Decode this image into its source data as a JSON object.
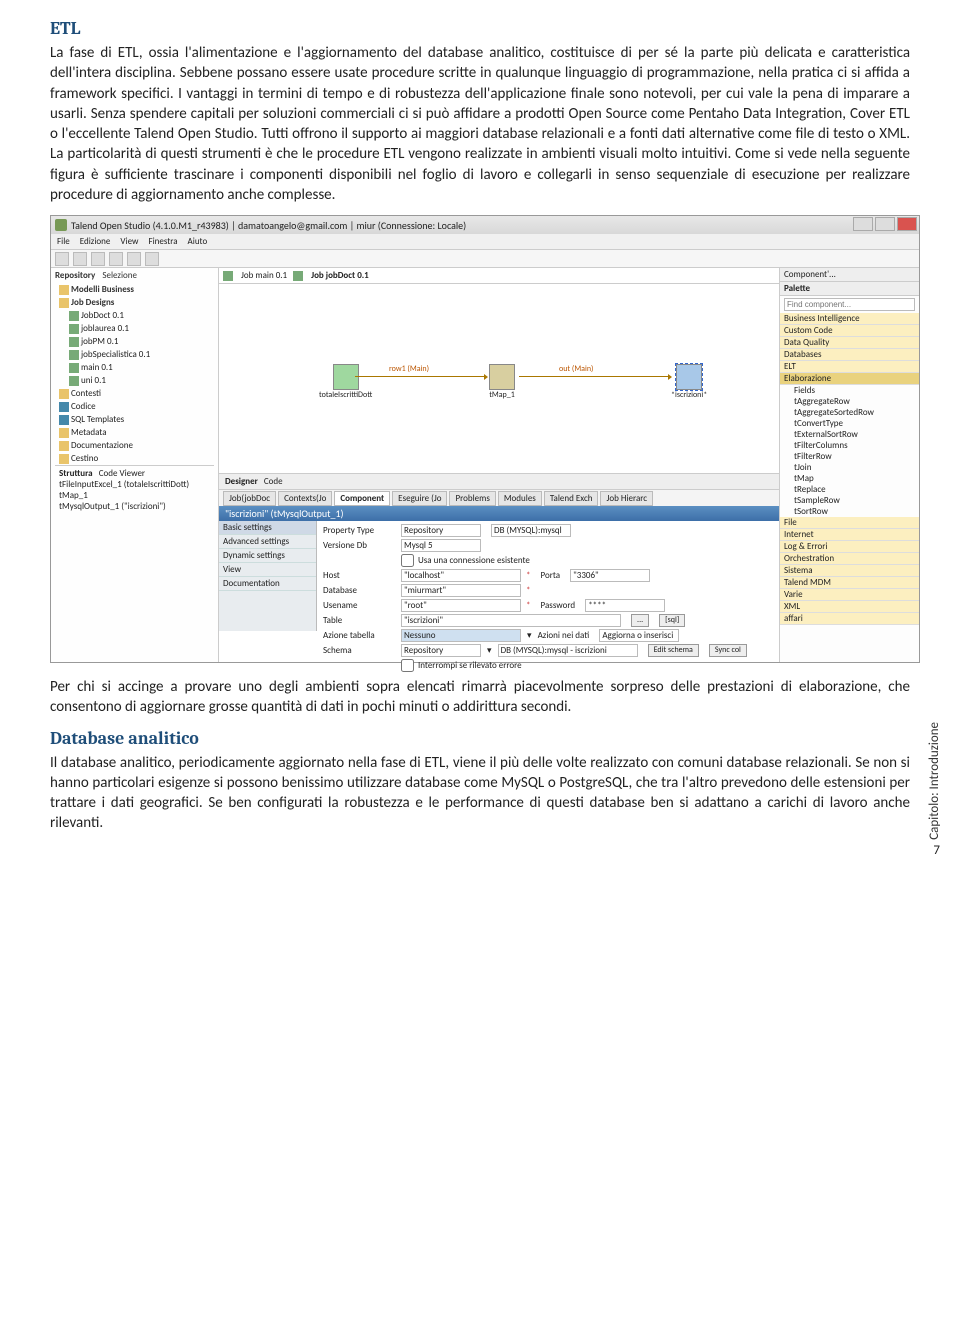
{
  "doc": {
    "section1_title": "ETL",
    "section1_body": "La fase di ETL, ossia l'alimentazione e l'aggiornamento del database analitico, costituisce di per sé la parte più delicata e caratteristica dell'intera disciplina. Sebbene possano essere usate procedure scritte in qualunque linguaggio di programmazione, nella pratica ci si affida a framework specifici. I vantaggi in termini di tempo e di robustezza dell'applicazione finale sono notevoli, per cui vale la pena di imparare a usarli. Senza spendere capitali per soluzioni commerciali ci si può affidare a prodotti Open Source come Pentaho Data Integration, Cover ETL o l'eccellente Talend Open Studio. Tutti offrono il supporto ai maggiori database relazionali e a fonti dati alternative come file di testo o XML. La particolarità di questi strumenti è che le procedure ETL vengono realizzate in ambienti visuali molto intuitivi. Come si vede nella seguente figura è sufficiente trascinare i componenti disponibili nel foglio di lavoro e collegarli in senso sequenziale di esecuzione per realizzare procedure di aggiornamento anche complesse.",
    "para2": "Per chi si accinge a provare uno degli ambienti sopra elencati rimarrà piacevolmente sorpreso delle prestazioni di elaborazione, che consentono di aggiornare grosse quantità di dati in pochi minuti o addirittura secondi.",
    "section2_title": "Database analitico",
    "section2_body": "Il database analitico, periodicamente aggiornato nella fase di ETL, viene il più delle volte realizzato con comuni database relazionali. Se non si hanno particolari esigenze si possono benissimo utilizzare database come MySQL o PostgreSQL, che tra l'altro prevedono delle estensioni per trattare i dati geografici. Se ben configurati la robustezza e le performance di questi database ben si adattano a carichi di lavoro anche rilevanti.",
    "side_caption": "Capitolo: Introduzione",
    "page_number": "7"
  },
  "talend": {
    "title": "Talend Open Studio (4.1.0.M1_r43983) | damatoangelo@gmail.com | miur (Connessione: Locale)",
    "menu": [
      "File",
      "Edizione",
      "View",
      "Finestra",
      "Aiuto"
    ],
    "left": {
      "tabs": [
        "Repository",
        "Selezione"
      ],
      "root_label": "Modelli Business",
      "job_designs": "Job Designs",
      "jobs": [
        "JobDoct 0.1",
        "joblaurea 0.1",
        "jobPM 0.1",
        "jobSpecialistica 0.1",
        "main 0.1",
        "uni 0.1"
      ],
      "others": [
        "Contesti",
        "Codice",
        "SQL Templates",
        "Metadata",
        "Documentazione",
        "Cestino"
      ]
    },
    "center": {
      "tabs": [
        "Job main 0.1",
        "Job jobDoct 0.1"
      ],
      "node1": "totaleIscrittiDott",
      "node2": "tMap_1",
      "node3": "*iscrizioni*",
      "link1": "row1 (Main)",
      "link2": "out (Main)",
      "designer_tabs": [
        "Designer",
        "Code"
      ],
      "bottom_tabs": [
        "Job(jobDoc",
        "Contexts(Jo",
        "Component",
        "Eseguire (Jo",
        "Problems",
        "Modules",
        "Talend Exch",
        "Job Hierarc"
      ],
      "comp_title": "\"iscrizioni\" (tMysqlOutput_1)",
      "side": [
        "Basic settings",
        "Advanced settings",
        "Dynamic settings",
        "View",
        "Documentation"
      ],
      "form": {
        "prop_type": "Property Type",
        "prop_val": "Repository",
        "db_col": "DB (MYSQL):mysql",
        "ver_lbl": "Versione Db",
        "ver_val": "Mysql 5",
        "cb": "Usa una connessione esistente",
        "host_lbl": "Host",
        "host_val": "\"localhost\"",
        "porta_lbl": "Porta",
        "porta_val": "\"3306\"",
        "db_lbl": "Database",
        "db_val": "\"miurmart\"",
        "user_lbl": "Usename",
        "user_val": "\"root\"",
        "pwd_lbl": "Password",
        "pwd_val": "****",
        "tbl_lbl": "Table",
        "tbl_val": "\"iscrizioni\"",
        "az_lbl": "Azione tabella",
        "az_val": "Nessuno",
        "azd_lbl": "Azioni nei dati",
        "azd_val": "Aggiorna o inserisci",
        "schema_lbl": "Schema",
        "schema_val": "Repository",
        "schema_db": "DB (MYSQL):mysql - iscrizioni",
        "edit_btn": "Edit schema",
        "sync_btn": "Sync col",
        "cb2": "Interrompi se rilevato errore"
      }
    },
    "struct": {
      "title": "Struttura",
      "cv": "Code Viewer",
      "items": [
        "tFileInputExcel_1 (totaleIscrittiDott)",
        "tMap_1",
        "tMysqlOutput_1 (\"iscrizioni\")"
      ]
    },
    "right": {
      "top": "Component'...",
      "palette": "Palette",
      "find": "Find component...",
      "cats": [
        "Business Intelligence",
        "Custom Code",
        "Data Quality",
        "Databases",
        "ELT"
      ],
      "sel": "Elaborazione",
      "items": [
        "Fields",
        "tAggregateRow",
        "tAggregateSortedRow",
        "tConvertType",
        "tExternalSortRow",
        "tFilterColumns",
        "tFilterRow",
        "tJoin",
        "tMap",
        "tReplace",
        "tSampleRow",
        "tSortRow"
      ],
      "cats2": [
        "File",
        "Internet",
        "Log & Errori",
        "Orchestration",
        "Sistema",
        "Talend MDM",
        "Varie",
        "XML",
        "affari"
      ]
    }
  }
}
